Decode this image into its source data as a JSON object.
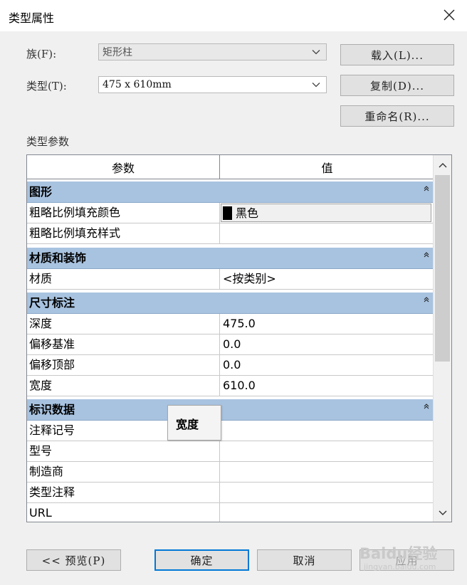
{
  "window": {
    "title": "类型属性"
  },
  "family": {
    "label": "族(F):",
    "value": "矩形柱"
  },
  "type": {
    "label": "类型(T):",
    "value": "475 x 610mm"
  },
  "buttons": {
    "load": "载入(L)...",
    "duplicate": "复制(D)...",
    "rename": "重命名(R)...",
    "preview": "<< 预览(P)",
    "ok": "确定",
    "cancel": "取消",
    "apply": "应用"
  },
  "section_label": "类型参数",
  "grid": {
    "headers": [
      "参数",
      "值"
    ],
    "groups": [
      {
        "name": "图形",
        "rows": [
          {
            "param": "粗略比例填充颜色",
            "value": "黑色",
            "swatch": "#000000"
          },
          {
            "param": "粗略比例填充样式",
            "value": ""
          }
        ]
      },
      {
        "name": "材质和装饰",
        "rows": [
          {
            "param": "材质",
            "value": "<按类别>"
          }
        ]
      },
      {
        "name": "尺寸标注",
        "rows": [
          {
            "param": "深度",
            "value": "475.0"
          },
          {
            "param": "偏移基准",
            "value": "0.0"
          },
          {
            "param": "偏移顶部",
            "value": "0.0"
          },
          {
            "param": "宽度",
            "value": "610.0"
          }
        ]
      },
      {
        "name": "标识数据",
        "rows": [
          {
            "param": "注释记号",
            "value": ""
          },
          {
            "param": "型号",
            "value": ""
          },
          {
            "param": "制造商",
            "value": ""
          },
          {
            "param": "类型注释",
            "value": ""
          },
          {
            "param": "URL",
            "value": ""
          }
        ]
      }
    ]
  },
  "tooltip": "宽度",
  "watermark": {
    "main": "Baidu经验",
    "sub": "jingyan.baidu.com"
  },
  "colors": {
    "group_header": "#a8c3e0",
    "primary_border": "#0078d7",
    "dialog_bg": "#f0f0f0"
  }
}
